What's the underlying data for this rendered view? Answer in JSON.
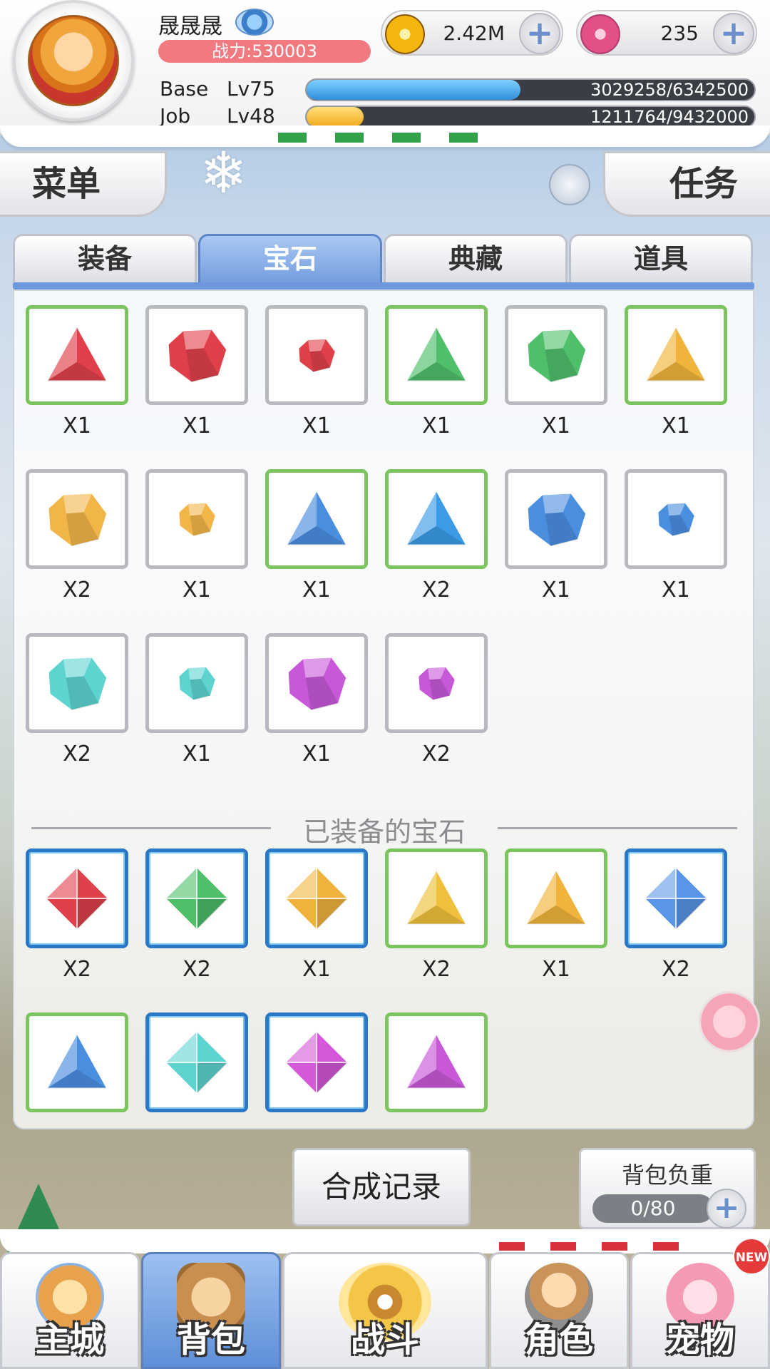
{
  "player": {
    "name": "晟晟晟",
    "power": "战力:530003",
    "base_label": "Base",
    "base_level": "Lv75",
    "base_exp": "3029258/6342500",
    "base_exp_fraction": 0.478,
    "job_label": "Job",
    "job_level": "Lv48",
    "job_exp": "1211764/9432000",
    "job_exp_fraction": 0.128
  },
  "resources": {
    "zeny": "2.42M",
    "gems": "235"
  },
  "buttons": {
    "menu": "菜单",
    "task": "任务",
    "record": "合成记录"
  },
  "tabs": [
    {
      "label": "装备",
      "active": false
    },
    {
      "label": "宝石",
      "active": true
    },
    {
      "label": "典藏",
      "active": false
    },
    {
      "label": "道具",
      "active": false
    }
  ],
  "inventory_gems": [
    {
      "icon": "red-triangle-gem-icon",
      "color": "#e0404a",
      "shape": "triangle",
      "border": "green",
      "qty": "X1"
    },
    {
      "icon": "red-rough-gem-icon",
      "color": "#e0404a",
      "shape": "rough",
      "border": "grey",
      "qty": "X1"
    },
    {
      "icon": "red-small-gem-icon",
      "color": "#e0404a",
      "shape": "small",
      "border": "grey",
      "qty": "X1"
    },
    {
      "icon": "green-triangle-gem-icon",
      "color": "#4fbf6a",
      "shape": "triangle",
      "border": "green",
      "qty": "X1"
    },
    {
      "icon": "green-rough-gem-icon",
      "color": "#4fbf6a",
      "shape": "rough",
      "border": "grey",
      "qty": "X1"
    },
    {
      "icon": "yellow-triangle-gem-icon",
      "color": "#f0b43c",
      "shape": "triangle",
      "border": "green",
      "qty": "X1"
    },
    {
      "icon": "yellow-rough-gem-icon",
      "color": "#f2b548",
      "shape": "rough",
      "border": "grey",
      "qty": "X2"
    },
    {
      "icon": "yellow-small-gem-icon",
      "color": "#f2b548",
      "shape": "small",
      "border": "grey",
      "qty": "X1"
    },
    {
      "icon": "blue-triangle-gem-icon",
      "color": "#4a8ee0",
      "shape": "triangle",
      "border": "green",
      "qty": "X1"
    },
    {
      "icon": "blue-triangle-gem-icon",
      "color": "#3b9be6",
      "shape": "triangle",
      "border": "green",
      "qty": "X2"
    },
    {
      "icon": "blue-rough-gem-icon",
      "color": "#4a8ee0",
      "shape": "rough",
      "border": "grey",
      "qty": "X1"
    },
    {
      "icon": "blue-small-gem-icon",
      "color": "#4a8ee0",
      "shape": "small",
      "border": "grey",
      "qty": "X1"
    },
    {
      "icon": "cyan-rough-gem-icon",
      "color": "#5ed4d0",
      "shape": "rough",
      "border": "grey",
      "qty": "X2"
    },
    {
      "icon": "cyan-small-gem-icon",
      "color": "#5ed4d0",
      "shape": "small",
      "border": "grey",
      "qty": "X1"
    },
    {
      "icon": "purple-rough-gem-icon",
      "color": "#c758d8",
      "shape": "rough",
      "border": "grey",
      "qty": "X1"
    },
    {
      "icon": "purple-small-gem-icon",
      "color": "#c758d8",
      "shape": "small",
      "border": "grey",
      "qty": "X2"
    }
  ],
  "equipped_title": "已装备的宝石",
  "equipped_gems": [
    {
      "icon": "red-diamond-gem-icon",
      "color": "#e0404a",
      "shape": "diamond",
      "border": "blue",
      "qty": "X2"
    },
    {
      "icon": "green-diamond-gem-icon",
      "color": "#4fbf6a",
      "shape": "diamond",
      "border": "blue",
      "qty": "X2"
    },
    {
      "icon": "yellow-diamond-gem-icon",
      "color": "#f0b43c",
      "shape": "diamond",
      "border": "blue",
      "qty": "X1"
    },
    {
      "icon": "yellow-triangle-gem-icon",
      "color": "#f0c03c",
      "shape": "triangle",
      "border": "green",
      "qty": "X2"
    },
    {
      "icon": "yellow-triangle-gem-icon",
      "color": "#f0b43c",
      "shape": "triangle",
      "border": "green",
      "qty": "X1"
    },
    {
      "icon": "blue-diamond-gem-icon",
      "color": "#5a96e6",
      "shape": "diamond",
      "border": "blue",
      "qty": "X2"
    },
    {
      "icon": "blue-triangle-gem-icon",
      "color": "#4a8ee0",
      "shape": "triangle",
      "border": "green",
      "qty": ""
    },
    {
      "icon": "cyan-diamond-gem-icon",
      "color": "#5ed4d0",
      "shape": "diamond",
      "border": "blue",
      "qty": ""
    },
    {
      "icon": "purple-diamond-gem-icon",
      "color": "#d458d8",
      "shape": "diamond",
      "border": "blue",
      "qty": ""
    },
    {
      "icon": "purple-triangle-gem-icon",
      "color": "#c858d8",
      "shape": "triangle",
      "border": "green",
      "qty": ""
    }
  ],
  "bag": {
    "title": "背包负重",
    "value": "0/80"
  },
  "nav": [
    {
      "label": "主城",
      "icon": "castle-icon",
      "active": false
    },
    {
      "label": "背包",
      "icon": "backpack-icon",
      "active": true
    },
    {
      "label": "战斗",
      "icon": "battle-wheel-icon",
      "active": false
    },
    {
      "label": "角色",
      "icon": "character-icon",
      "active": false
    },
    {
      "label": "宠物",
      "icon": "pet-poring-icon",
      "active": false
    }
  ],
  "new_badge": "NEW",
  "colors": {
    "accent_blue": "#6d98dd",
    "power_red": "#f07a80",
    "base_exp": "#3fa6e8",
    "job_exp": "#f5b82e"
  }
}
